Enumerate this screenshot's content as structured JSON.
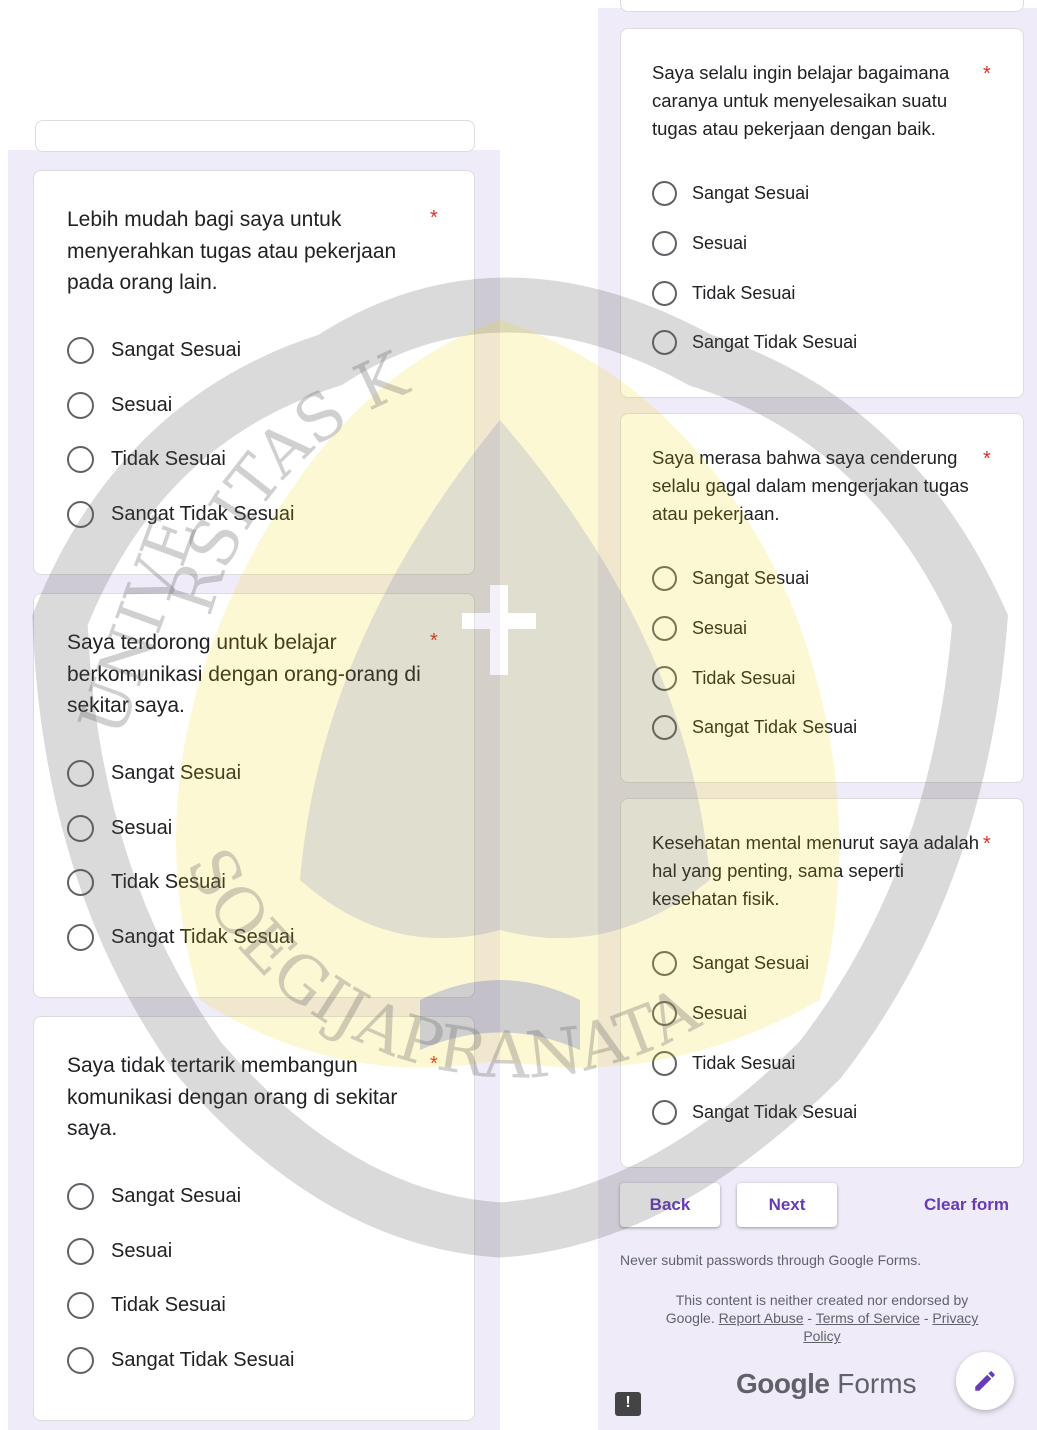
{
  "required_mark": "*",
  "options": [
    "Sangat Sesuai",
    "Sesuai",
    "Tidak Sesuai",
    "Sangat Tidak Sesuai"
  ],
  "left_questions": [
    "Lebih mudah bagi saya untuk menyerahkan tugas atau pekerjaan pada orang lain.",
    "Saya terdorong untuk belajar berkomunikasi dengan orang-orang di sekitar saya.",
    "Saya tidak tertarik membangun komunikasi dengan orang di sekitar saya."
  ],
  "right_questions": [
    "Saya selalu ingin belajar bagaimana caranya untuk menyelesaikan suatu tugas atau pekerjaan dengan baik.",
    "Saya merasa bahwa saya cenderung selalu gagal dalam mengerjakan tugas atau pekerjaan.",
    "Kesehatan mental menurut saya adalah hal yang penting, sama seperti kesehatan fisik."
  ],
  "nav": {
    "back": "Back",
    "next": "Next",
    "clear": "Clear form"
  },
  "footer": {
    "password_warning": "Never submit passwords through Google Forms.",
    "disclaimer_prefix": "This content is neither created nor endorsed by Google.",
    "report_abuse": "Report Abuse",
    "terms": "Terms of Service",
    "privacy": "Privacy Policy",
    "separator": " - ",
    "brand_google": "Google",
    "brand_forms": "Forms",
    "feedback_glyph": "!"
  },
  "watermark": {
    "arc_text_top": "RSITAS K",
    "arc_text_bottom": "SOEGIJAPRANATA",
    "letters_side": "UNIVE"
  },
  "colors": {
    "accent": "#673ab7",
    "required": "#d93025",
    "panel": "#f0ebf8"
  }
}
